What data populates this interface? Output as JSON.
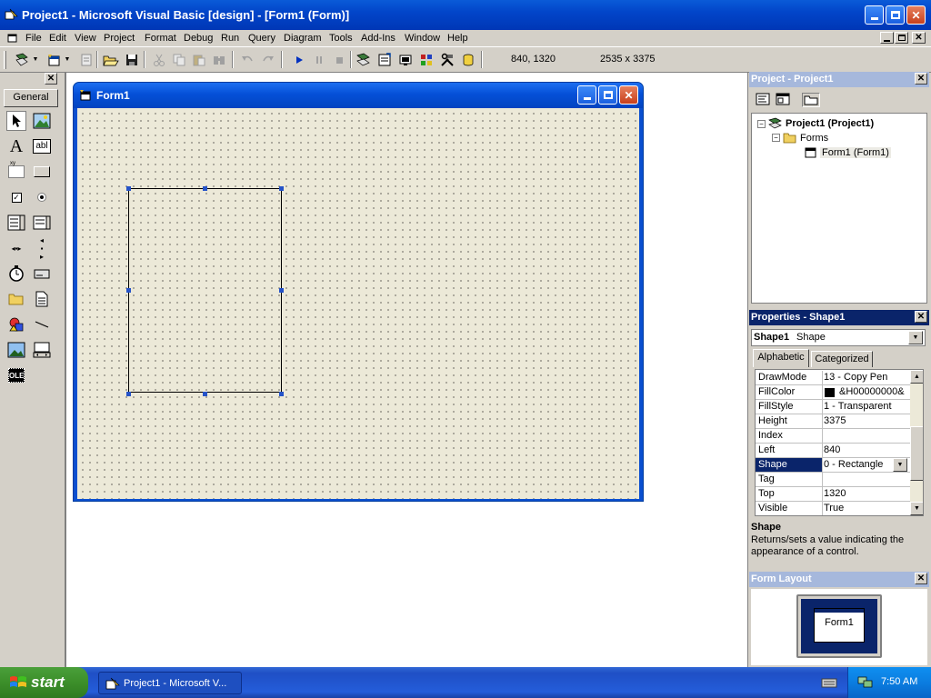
{
  "window": {
    "title": "Project1 - Microsoft Visual Basic [design] - [Form1 (Form)]"
  },
  "menu": {
    "items": [
      "File",
      "Edit",
      "View",
      "Project",
      "Format",
      "Debug",
      "Run",
      "Query",
      "Diagram",
      "Tools",
      "Add-Ins",
      "Window",
      "Help"
    ]
  },
  "toolbar": {
    "position": "840, 1320",
    "size": "2535 x 3375"
  },
  "toolbox": {
    "tab_label": "General"
  },
  "form": {
    "title": "Form1"
  },
  "project": {
    "panel_title": "Project - Project1",
    "root": "Project1 (Project1)",
    "folder": "Forms",
    "item": "Form1 (Form1)"
  },
  "properties": {
    "panel_title": "Properties - Shape1",
    "object_name": "Shape1",
    "object_type": "Shape",
    "tabs": [
      "Alphabetic",
      "Categorized"
    ],
    "rows": [
      {
        "name": "DrawMode",
        "value": "13 - Copy Pen"
      },
      {
        "name": "FillColor",
        "value": "&H00000000&"
      },
      {
        "name": "FillStyle",
        "value": "1 - Transparent"
      },
      {
        "name": "Height",
        "value": "3375"
      },
      {
        "name": "Index",
        "value": ""
      },
      {
        "name": "Left",
        "value": "840"
      },
      {
        "name": "Shape",
        "value": "0 - Rectangle"
      },
      {
        "name": "Tag",
        "value": ""
      },
      {
        "name": "Top",
        "value": "1320"
      },
      {
        "name": "Visible",
        "value": "True"
      }
    ],
    "description_title": "Shape",
    "description_text": "Returns/sets a value indicating the appearance of a control."
  },
  "form_layout": {
    "panel_title": "Form Layout",
    "preview_label": "Form1"
  },
  "taskbar": {
    "start_label": "start",
    "task_label": "Project1 - Microsoft V...",
    "clock": "7:50 AM"
  },
  "colors": {
    "xp_blue": "#0245c9",
    "selection": "#0a246a",
    "handle": "#2553c8",
    "start_green": "#3c8f2a"
  }
}
